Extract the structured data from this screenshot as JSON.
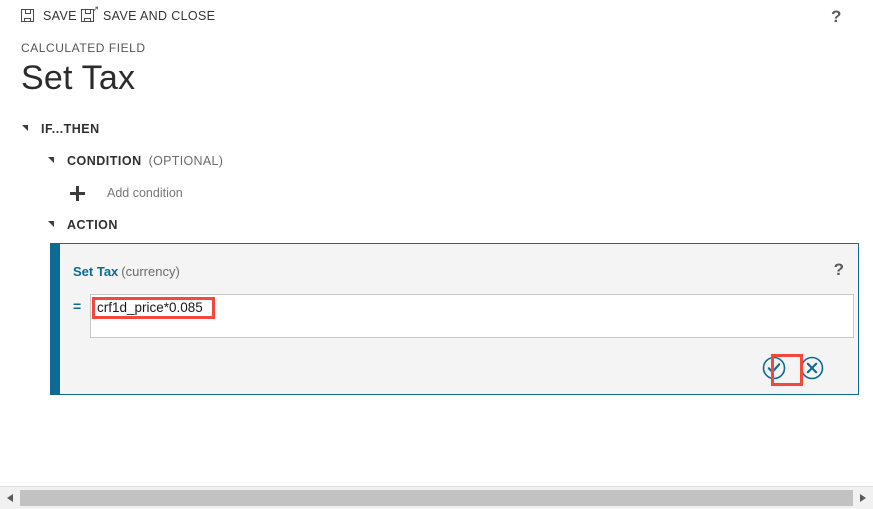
{
  "commandbar": {
    "save_label": "SAVE",
    "save_and_close_label": "SAVE AND CLOSE",
    "help_label": "?"
  },
  "header": {
    "eyebrow": "CALCULATED FIELD",
    "title": "Set Tax"
  },
  "tree": {
    "root_label": "IF...THEN",
    "condition_label": "CONDITION",
    "condition_optional": "(OPTIONAL)",
    "add_condition_label": "Add condition",
    "action_label": "ACTION"
  },
  "action_panel": {
    "field_name": "Set Tax",
    "field_type": "(currency)",
    "help_label": "?",
    "equals_sign": "=",
    "formula_value": "crf1d_price*0.085",
    "formula_placeholder": "",
    "confirm_icon": "check-circle-icon",
    "cancel_icon": "cancel-circle-icon"
  },
  "colors": {
    "accent": "#0c6a94",
    "highlight": "#f4483c",
    "panel_background": "#f4f4f4",
    "text": "#333333"
  },
  "scrollbar": {
    "left_arrow": "chevron-left-icon",
    "right_arrow": "chevron-right-icon"
  }
}
